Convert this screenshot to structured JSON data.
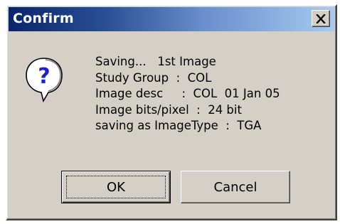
{
  "window": {
    "title": "Confirm",
    "close_icon": "close-icon",
    "colors": {
      "face": "#d4d0c8",
      "title_start": "#0a246a",
      "title_end": "#a6caf0",
      "icon_blue": "#1f1fd0"
    }
  },
  "icon": {
    "name": "question-icon",
    "glyph": "?"
  },
  "message": {
    "lines": [
      "Saving...   1st Image",
      "Study Group  :  COL",
      "Image desc     :  COL  01 Jan 05",
      "Image bits/pixel  :  24 bit",
      "saving as ImageType  :  TGA"
    ]
  },
  "buttons": {
    "ok_label": "OK",
    "cancel_label": "Cancel"
  }
}
